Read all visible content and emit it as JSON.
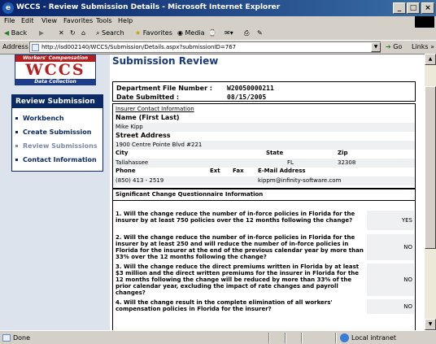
{
  "window": {
    "title": "WCCS - Review Submission Details - Microsoft Internet Explorer"
  },
  "menu": [
    "File",
    "Edit",
    "View",
    "Favorites",
    "Tools",
    "Help"
  ],
  "toolbar": {
    "back": "Back",
    "search": "Search",
    "favorites": "Favorites",
    "media": "Media"
  },
  "address": {
    "label": "Address",
    "url": "http://isd002140/WCCS/Submission/Details.aspx?submissionID=767",
    "go": "Go",
    "links": "Links"
  },
  "logo": {
    "top": "Workers' Compensation",
    "big": "WCCS",
    "bottom": "Data Collection"
  },
  "nav": {
    "header": "Review Submission",
    "items": [
      "Workbench",
      "Create Submission",
      "Review Submissions",
      "Contact Information"
    ]
  },
  "page": {
    "title": "Submission Review",
    "dept_label": "Department File Number :",
    "dept_value": "W20050000211",
    "date_label": "Date Submitted :",
    "date_value": "08/15/2005"
  },
  "contact": {
    "section": "Insurer Contact Information",
    "name_label": "Name (First Last)",
    "name": "Mike Kipp",
    "street_label": "Street Address",
    "street": "1900 Centre Pointe Blvd #221",
    "city_label": "City",
    "state_label": "State",
    "zip_label": "Zip",
    "city": "Tallahassee",
    "state": "FL",
    "zip": "32308",
    "phone_label": "Phone",
    "ext_label": "Ext",
    "fax_label": "Fax",
    "email_label": "E-Mail Address",
    "phone": "(850) 413 - 2519",
    "email": "kippm@infinity-software.com"
  },
  "questionnaire": {
    "header": "Significant Change Questionnaire Information",
    "questions": [
      {
        "text": "1. Will the change reduce the number of in-force policies in Florida for the insurer by at least 750 policies over the 12 months following the change?",
        "answer": "YES"
      },
      {
        "text": "2. Will the change reduce the number of in-force policies in Florida for the insurer by at least 250 and will reduce the number of in-force policies in Florida for the insurer at the end of the previous calendar year by more than 33% over the 12 months following the change?",
        "answer": "NO"
      },
      {
        "text": "3. Will the change reduce the direct premiums written in Florida by at least $3 million and the direct written premiums for the insurer in Florida for the 12 months following the change will be reduced by more than 33% of the prior calendar year, excluding the impact of rate changes and payroll changes?",
        "answer": "NO"
      },
      {
        "text": "4. Will the change result in the complete elimination of all workers' compensation policies in Florida for the insurer?",
        "answer": "NO"
      }
    ]
  },
  "status": {
    "text": "Done",
    "zone": "Local intranet"
  }
}
